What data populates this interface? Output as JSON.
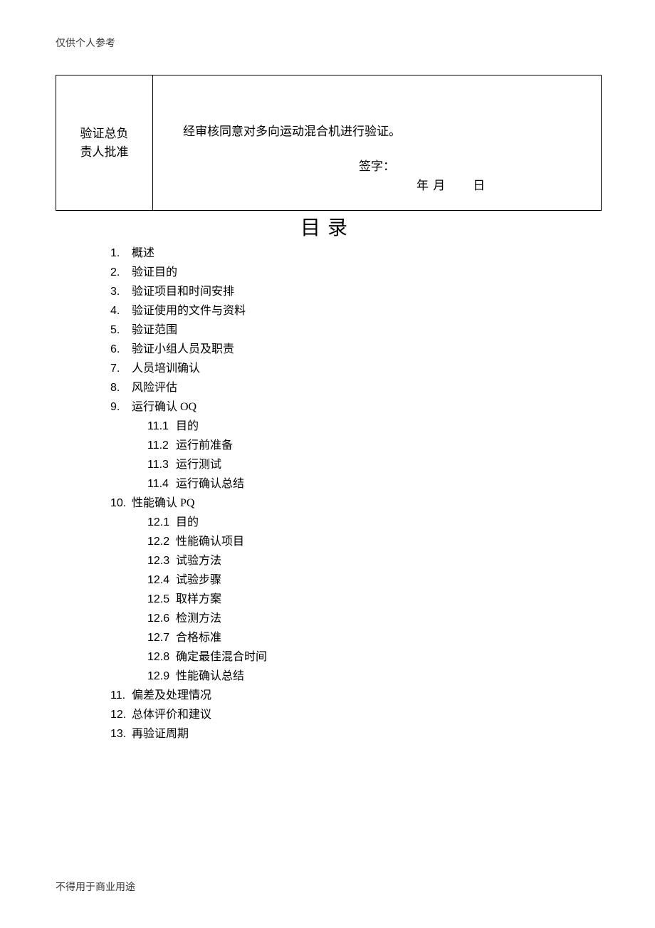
{
  "header_note": "仅供个人参考",
  "approval": {
    "left_line1": "验证总负",
    "left_line2": "责人批准",
    "statement": "经审核同意对多向运动混合机进行验证。",
    "signature_label": "签字：",
    "date_year": "年",
    "date_month": "月",
    "date_day": "日"
  },
  "toc_title": "目录",
  "toc": [
    {
      "n": "1.",
      "t": "概述"
    },
    {
      "n": "2.",
      "t": "验证目的"
    },
    {
      "n": "3.",
      "t": "验证项目和时间安排"
    },
    {
      "n": "4.",
      "t": "验证使用的文件与资料"
    },
    {
      "n": "5.",
      "t": "验证范围"
    },
    {
      "n": "6.",
      "t": "验证小组人员及职责"
    },
    {
      "n": "7.",
      "t": "人员培训确认"
    },
    {
      "n": "8.",
      "t": "风险评估"
    },
    {
      "n": "9.",
      "t": "运行确认 OQ",
      "sub": [
        {
          "n": "11.1",
          "t": "目的"
        },
        {
          "n": "11.2",
          "t": "运行前准备"
        },
        {
          "n": "11.3",
          "t": "运行测试"
        },
        {
          "n": "11.4",
          "t": "运行确认总结"
        }
      ]
    },
    {
      "n": "10.",
      "t": "性能确认 PQ",
      "sub": [
        {
          "n": "12.1",
          "t": "目的"
        },
        {
          "n": "12.2",
          "t": "性能确认项目"
        },
        {
          "n": "12.3",
          "t": "试验方法"
        },
        {
          "n": "12.4",
          "t": "试验步骤"
        },
        {
          "n": "12.5",
          "t": "取样方案"
        },
        {
          "n": "12.6",
          "t": "检测方法"
        },
        {
          "n": "12.7",
          "t": "合格标准"
        },
        {
          "n": "12.8",
          "t": "确定最佳混合时间"
        },
        {
          "n": "12.9",
          "t": "性能确认总结"
        }
      ]
    },
    {
      "n": "11.",
      "t": "偏差及处理情况"
    },
    {
      "n": "12.",
      "t": "总体评价和建议"
    },
    {
      "n": "13.",
      "t": "再验证周期"
    }
  ],
  "footer_note": "不得用于商业用途"
}
